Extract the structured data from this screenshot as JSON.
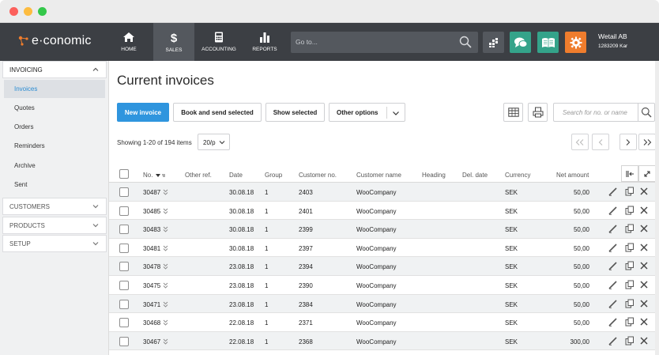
{
  "app": {
    "logo_text": "e·conomic"
  },
  "nav": {
    "items": [
      {
        "label": "HOME",
        "icon": "home-icon"
      },
      {
        "label": "SALES",
        "icon": "dollar-icon"
      },
      {
        "label": "ACCOUNTING",
        "icon": "calculator-icon"
      },
      {
        "label": "REPORTS",
        "icon": "bar-chart-icon"
      }
    ],
    "active": "SALES",
    "goto_placeholder": "Go to...",
    "company_name": "Wetail AB",
    "company_number": "1283209 Kar"
  },
  "sidebar": {
    "invoicing_label": "INVOICING",
    "items": [
      {
        "label": "Invoices"
      },
      {
        "label": "Quotes"
      },
      {
        "label": "Orders"
      },
      {
        "label": "Reminders"
      },
      {
        "label": "Archive"
      },
      {
        "label": "Sent"
      }
    ],
    "active_item": "Invoices",
    "sections": [
      {
        "label": "CUSTOMERS"
      },
      {
        "label": "PRODUCTS"
      },
      {
        "label": "SETUP"
      }
    ]
  },
  "main": {
    "title": "Current invoices",
    "toolbar": {
      "new_invoice": "New invoice",
      "book_send": "Book and send selected",
      "show_selected": "Show selected",
      "other_options": "Other options"
    },
    "search_placeholder": "Search for no. or name",
    "showing": "Showing 1-20 of 194 items",
    "per_page": "20/p"
  },
  "table": {
    "headers": {
      "no": "No.",
      "other_ref": "Other ref.",
      "date": "Date",
      "group": "Group",
      "customer_no": "Customer no.",
      "customer_name": "Customer name",
      "heading": "Heading",
      "del_date": "Del. date",
      "currency": "Currency",
      "net_amount": "Net amount"
    },
    "rows": [
      {
        "no": "30487",
        "date": "30.08.18",
        "group": "1",
        "customer_no": "2403",
        "customer_name": "WooCompany",
        "currency": "SEK",
        "net_amount": "50,00"
      },
      {
        "no": "30485",
        "date": "30.08.18",
        "group": "1",
        "customer_no": "2401",
        "customer_name": "WooCompany",
        "currency": "SEK",
        "net_amount": "50,00"
      },
      {
        "no": "30483",
        "date": "30.08.18",
        "group": "1",
        "customer_no": "2399",
        "customer_name": "WooCompany",
        "currency": "SEK",
        "net_amount": "50,00"
      },
      {
        "no": "30481",
        "date": "30.08.18",
        "group": "1",
        "customer_no": "2397",
        "customer_name": "WooCompany",
        "currency": "SEK",
        "net_amount": "50,00"
      },
      {
        "no": "30478",
        "date": "23.08.18",
        "group": "1",
        "customer_no": "2394",
        "customer_name": "WooCompany",
        "currency": "SEK",
        "net_amount": "50,00"
      },
      {
        "no": "30475",
        "date": "23.08.18",
        "group": "1",
        "customer_no": "2390",
        "customer_name": "WooCompany",
        "currency": "SEK",
        "net_amount": "50,00"
      },
      {
        "no": "30471",
        "date": "23.08.18",
        "group": "1",
        "customer_no": "2384",
        "customer_name": "WooCompany",
        "currency": "SEK",
        "net_amount": "50,00"
      },
      {
        "no": "30468",
        "date": "22.08.18",
        "group": "1",
        "customer_no": "2371",
        "customer_name": "WooCompany",
        "currency": "SEK",
        "net_amount": "50,00"
      },
      {
        "no": "30467",
        "date": "22.08.18",
        "group": "1",
        "customer_no": "2368",
        "customer_name": "WooCompany",
        "currency": "SEK",
        "net_amount": "300,00"
      }
    ]
  },
  "colors": {
    "nav_bg": "#3c3f44",
    "primary": "#2f95de",
    "chat_tile": "#34a38a",
    "gear_tile": "#ef7d2d"
  }
}
